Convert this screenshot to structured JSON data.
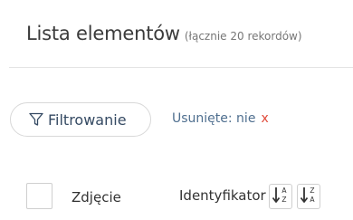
{
  "header": {
    "title": "Lista elementów",
    "count_text": "(łącznie 20 rekordów)"
  },
  "filters": {
    "button_label": "Filtrowanie",
    "button_icon": "funnel-icon",
    "active_filter_text": "Usunięte: nie",
    "remove_label": "x"
  },
  "table": {
    "columns": [
      {
        "label": "Zdjęcie"
      },
      {
        "label": "Identyfikator"
      }
    ],
    "sort_icons": [
      "sort-ascending-icon",
      "sort-descending-icon"
    ]
  },
  "colors": {
    "title": "#3b3b3b",
    "filter_text": "#4f6f8f",
    "remove": "#e04a3a",
    "border": "#d8d8d8"
  }
}
